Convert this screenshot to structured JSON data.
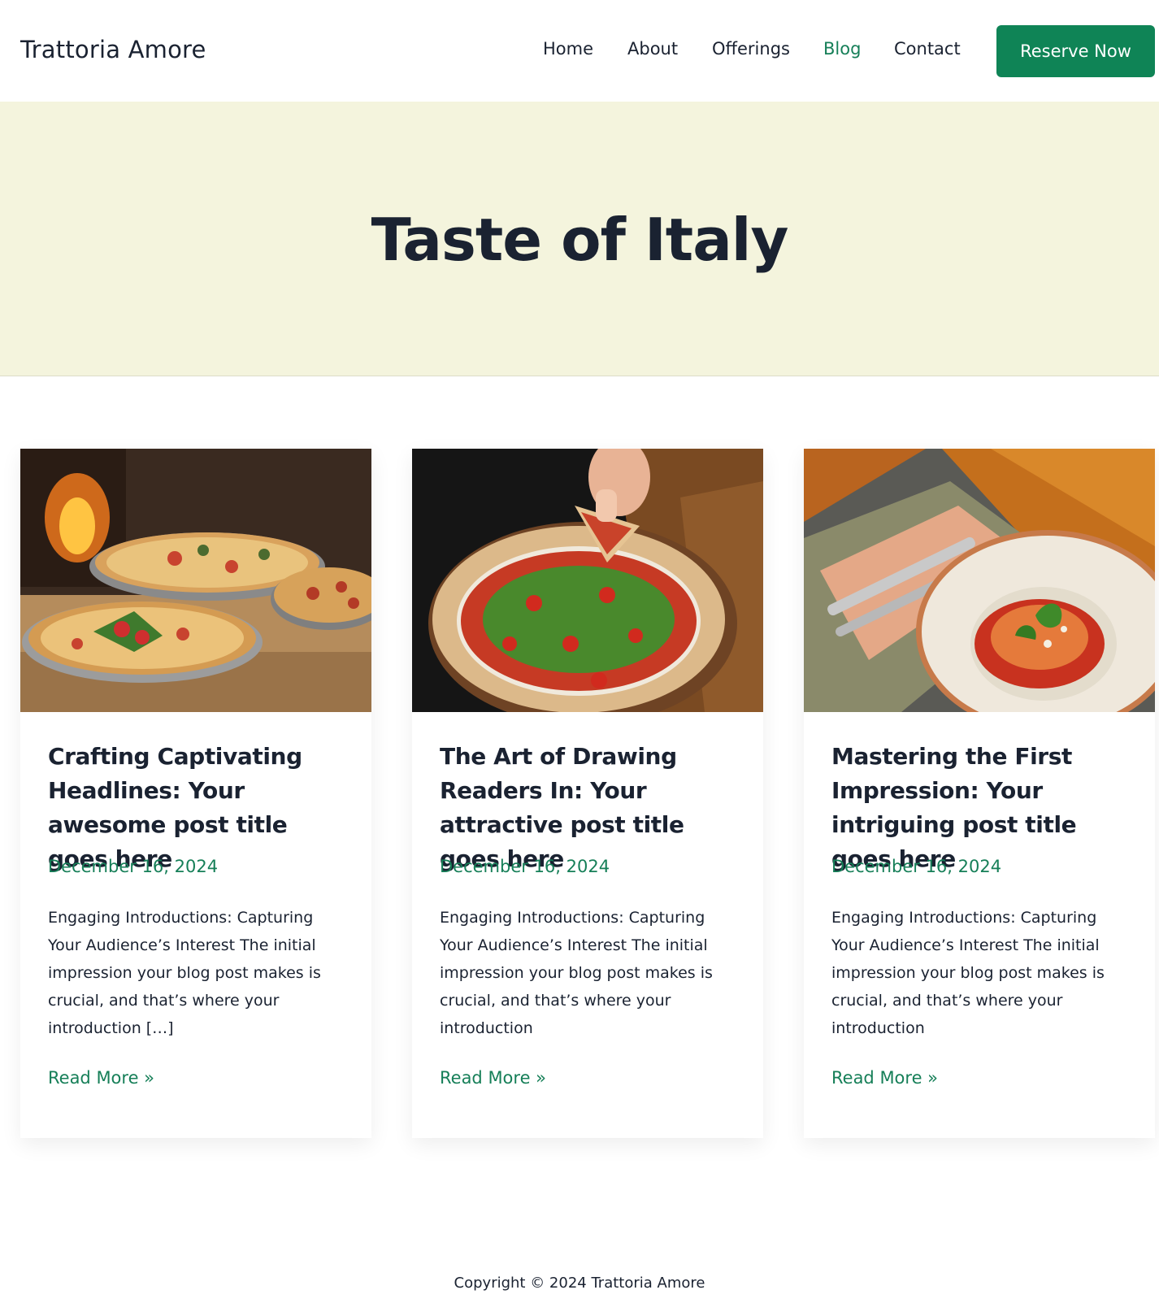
{
  "site": {
    "logo": "Trattoria Amore"
  },
  "nav": {
    "items": [
      "Home",
      "About",
      "Offerings",
      "Blog",
      "Contact"
    ],
    "active": "Blog",
    "cta": "Reserve Now"
  },
  "hero": {
    "title": "Taste of Italy"
  },
  "posts": [
    {
      "image": "wood-fired-pizzas-photo",
      "title": "Crafting Captivating Headlines: Your awesome post title goes here",
      "date": "December 16, 2024",
      "excerpt": "Engaging Introductions: Capturing Your Audience’s Interest The initial impression your blog post makes is crucial, and that’s where your introduction […]",
      "read_more": "Read More »"
    },
    {
      "image": "arugula-pizza-slice-photo",
      "title": "The Art of Drawing Readers In: Your attractive post title goes here",
      "date": "December 16, 2024",
      "excerpt": "Engaging Introductions: Capturing Your Audience’s Interest The initial impression your blog post makes is crucial, and that’s where your introduction",
      "read_more": "Read More »"
    },
    {
      "image": "spaghetti-bowl-photo",
      "title": "Mastering the First Impression: Your intriguing post title goes here",
      "date": "December 16, 2024",
      "excerpt": "Engaging Introductions: Capturing Your Audience’s Interest The initial impression your blog post makes is crucial, and that’s where your introduction",
      "read_more": "Read More »"
    }
  ],
  "footer": {
    "copyright": "Copyright © 2024 Trattoria Amore"
  },
  "colors": {
    "accent": "#0f8456",
    "link": "#167f58",
    "hero_bg": "#f4f4dd",
    "text": "#1a2231"
  }
}
